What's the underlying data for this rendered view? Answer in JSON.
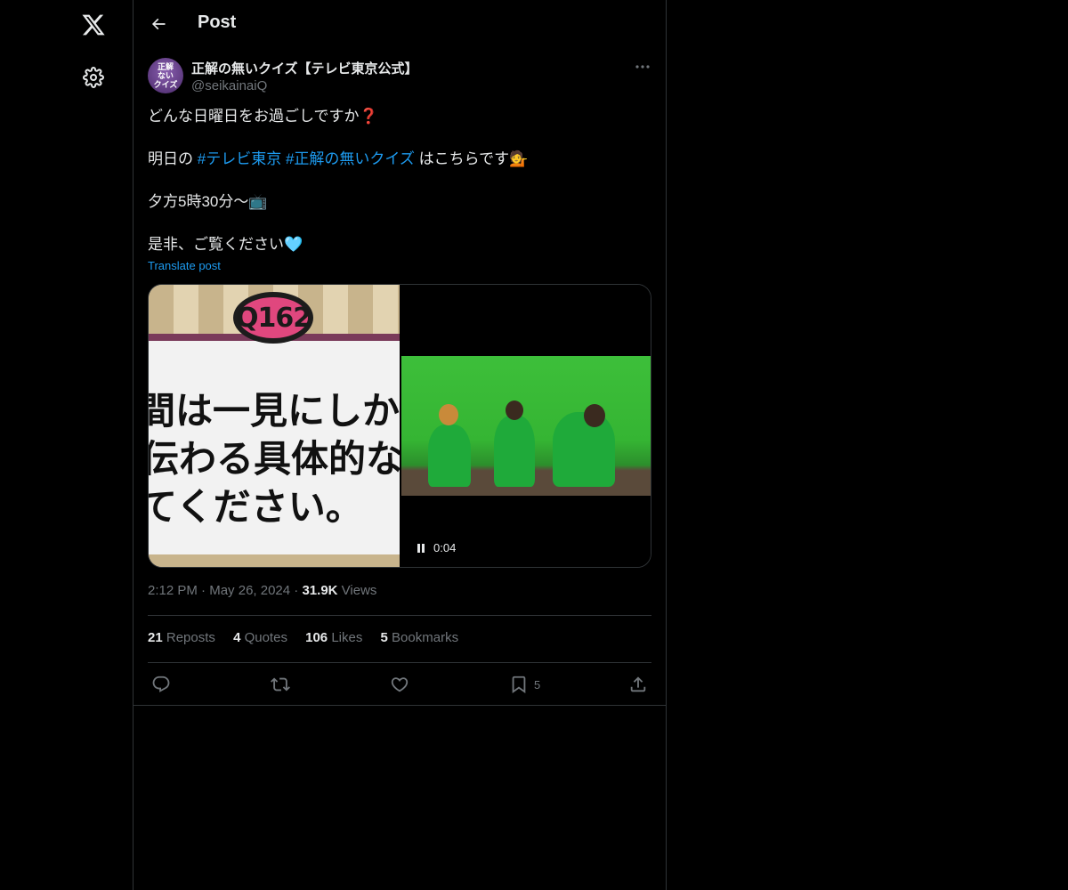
{
  "nav": {
    "logo_icon": "x-logo-icon",
    "settings_icon": "gear-icon"
  },
  "header": {
    "title": "Post",
    "back_icon": "arrow-left-icon"
  },
  "author": {
    "name": "正解の無いクイズ【テレビ東京公式】",
    "handle": "@seikainaiQ",
    "avatar_text_1": "正解",
    "avatar_text_2": "ない",
    "avatar_text_3": "クイズ"
  },
  "tweet": {
    "line1": "どんな日曜日をお過ごしですか❓",
    "line2_prefix": "明日の ",
    "hashtag1": "#テレビ東京",
    "hashtag2": "#正解の無いクイズ",
    "line2_suffix": " はこちらです💁",
    "line3": "夕方5時30分〜📺",
    "line4": "是非、ご覧ください🩵",
    "translate": "Translate post"
  },
  "media": {
    "quiz_badge": "Q162",
    "quiz_line1": "間は一見にしかず",
    "quiz_line2": "伝わる具体的な",
    "quiz_line3": "てください。",
    "video_time": "0:04",
    "pause_icon": "pause-icon"
  },
  "meta": {
    "time": "2:12 PM",
    "date": "May 26, 2024",
    "views_count": "31.9K",
    "views_label": "Views"
  },
  "stats": {
    "reposts_count": "21",
    "reposts_label": "Reposts",
    "quotes_count": "4",
    "quotes_label": "Quotes",
    "likes_count": "106",
    "likes_label": "Likes",
    "bookmarks_count": "5",
    "bookmarks_label": "Bookmarks"
  },
  "actions": {
    "reply_icon": "reply-icon",
    "repost_icon": "repost-icon",
    "like_icon": "heart-icon",
    "bookmark_icon": "bookmark-icon",
    "bookmark_count": "5",
    "share_icon": "share-icon"
  },
  "colors": {
    "accent": "#1d9bf0",
    "background": "#000000",
    "text": "#e7e9ea",
    "muted": "#71767b",
    "border": "#2f3336"
  }
}
